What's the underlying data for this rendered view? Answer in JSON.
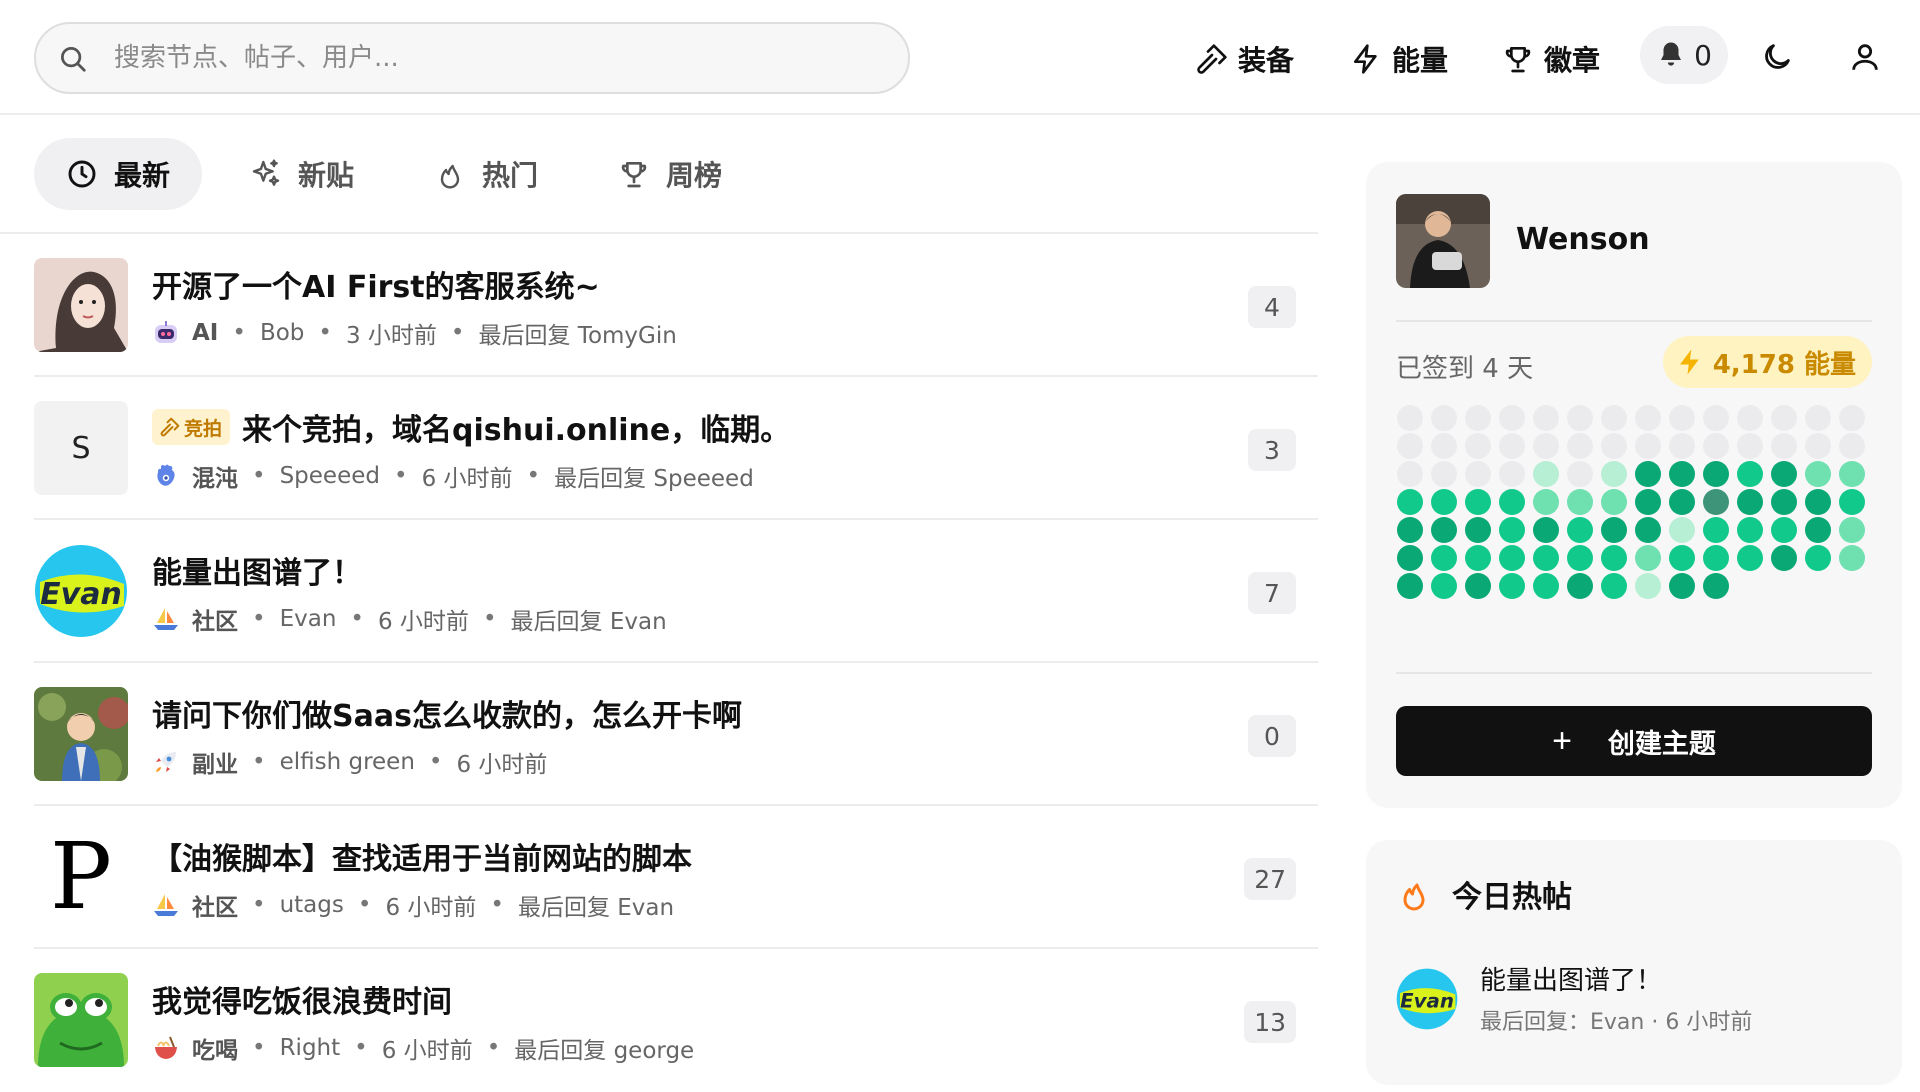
{
  "search": {
    "placeholder": "搜索节点、帖子、用户..."
  },
  "header": {
    "nav": [
      {
        "label": "装备",
        "icon": "hammer-icon"
      },
      {
        "label": "能量",
        "icon": "lightning-icon"
      },
      {
        "label": "徽章",
        "icon": "trophy-icon"
      }
    ],
    "notifications": "0"
  },
  "tabs": [
    {
      "label": "最新",
      "icon": "clock-icon",
      "active": true
    },
    {
      "label": "新贴",
      "icon": "sparkles-icon",
      "active": false
    },
    {
      "label": "热门",
      "icon": "flame-icon",
      "active": false
    },
    {
      "label": "周榜",
      "icon": "trophy-icon",
      "active": false
    }
  ],
  "topics": [
    {
      "title": "开源了一个AI First的客服系统~",
      "node": "AI",
      "node_icon": "robot-icon",
      "author": "Bob",
      "time": "3 小时前",
      "last_reply": "最后回复 TomyGin",
      "count": "4",
      "avatar": "photo-woman"
    },
    {
      "title": "来个竞拍，域名qishui.online，临期。",
      "tag": "竞拍",
      "node": "混沌",
      "node_icon": "hamsa-icon",
      "author": "Speeeed",
      "time": "6 小时前",
      "last_reply": "最后回复 Speeeed",
      "count": "3",
      "avatar": "letter",
      "avatar_letter": "S"
    },
    {
      "title": "能量出图谱了！",
      "node": "社区",
      "node_icon": "boat-icon",
      "author": "Evan",
      "time": "6 小时前",
      "last_reply": "最后回复 Evan",
      "count": "7",
      "avatar": "evan-logo"
    },
    {
      "title": "请问下你们做Saas怎么收款的，怎么开卡啊",
      "node": "副业",
      "node_icon": "rocket-icon",
      "author": "elfish green",
      "time": "6 小时前",
      "last_reply": "",
      "count": "0",
      "avatar": "photo-child"
    },
    {
      "title": "【油猴脚本】查找适用于当前网站的脚本",
      "node": "社区",
      "node_icon": "boat-icon",
      "author": "utags",
      "time": "6 小时前",
      "last_reply": "最后回复 Evan",
      "count": "27",
      "avatar": "letter-p",
      "avatar_letter": "P"
    },
    {
      "title": "我觉得吃饭很浪费时间",
      "node": "吃喝",
      "node_icon": "noodle-icon",
      "author": "Right",
      "time": "6 小时前",
      "last_reply": "最后回复 george",
      "count": "13",
      "avatar": "frog"
    }
  ],
  "profile": {
    "name": "Wenson",
    "checkin": "已签到 4 天",
    "energy": "4,178 能量",
    "create_label": "创建主题"
  },
  "heatmap": {
    "colors": {
      "0": "#ebebed",
      "1": "#b6efd4",
      "2": "#6fe0b0",
      "3": "#10c98b",
      "4": "#0aa875",
      "5": "#3d9479"
    },
    "rows": [
      [
        0,
        0,
        0,
        0,
        0,
        0,
        0,
        0,
        0,
        0,
        0,
        0,
        0,
        0
      ],
      [
        0,
        0,
        0,
        0,
        0,
        0,
        0,
        0,
        0,
        0,
        0,
        0,
        0,
        0
      ],
      [
        0,
        0,
        0,
        0,
        1,
        0,
        1,
        4,
        4,
        4,
        3,
        4,
        2,
        2
      ],
      [
        3,
        3,
        3,
        3,
        2,
        2,
        2,
        4,
        4,
        5,
        4,
        4,
        4,
        3
      ],
      [
        4,
        4,
        4,
        3,
        4,
        3,
        4,
        4,
        1,
        3,
        3,
        3,
        4,
        2
      ],
      [
        4,
        3,
        3,
        3,
        3,
        3,
        3,
        2,
        3,
        3,
        3,
        4,
        3,
        2
      ],
      [
        4,
        3,
        4,
        3,
        3,
        4,
        3,
        1,
        4,
        4
      ]
    ]
  },
  "hot": {
    "title": "今日热帖",
    "items": [
      {
        "title": "能量出图谱了！",
        "meta": "最后回复：Evan · 6 小时前"
      }
    ]
  }
}
